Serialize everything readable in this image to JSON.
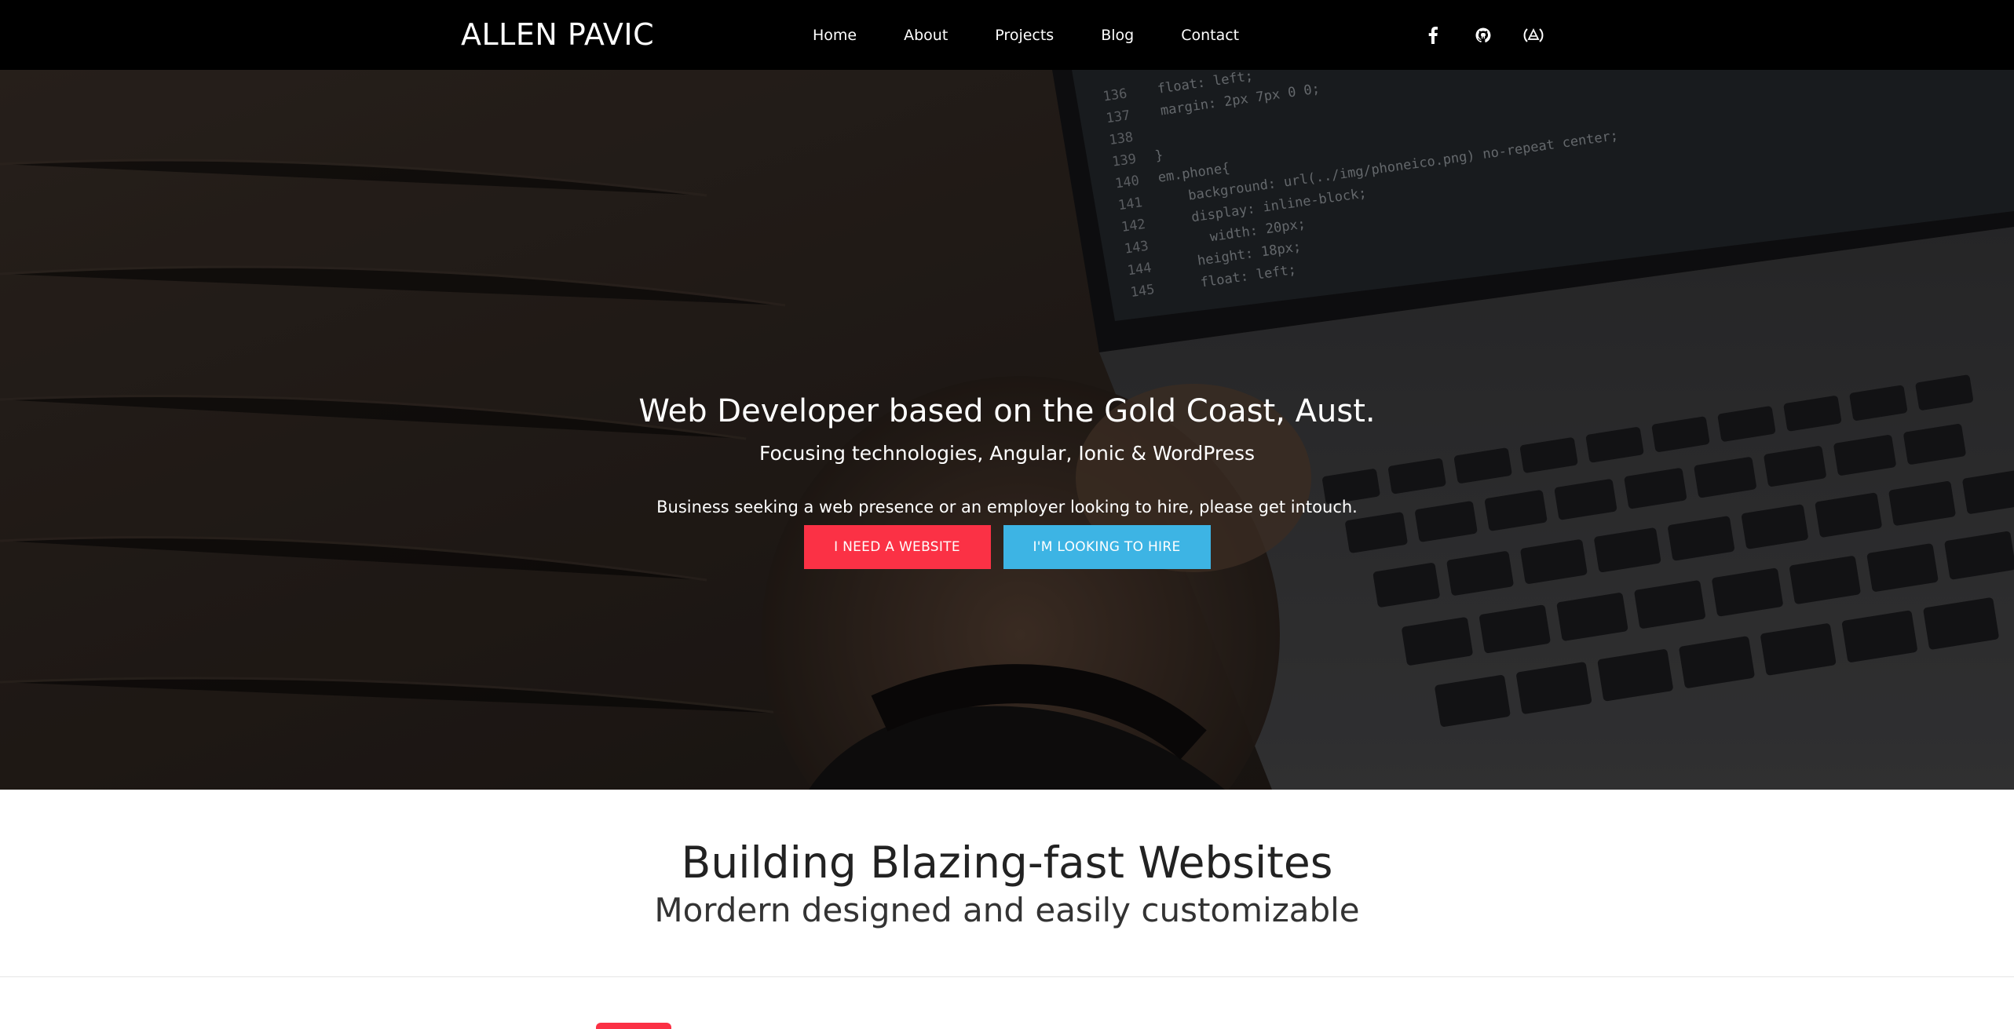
{
  "brand": {
    "name": "ALLEN PAVIC"
  },
  "nav": {
    "items": [
      {
        "label": "Home"
      },
      {
        "label": "About"
      },
      {
        "label": "Projects"
      },
      {
        "label": "Blog"
      },
      {
        "label": "Contact"
      }
    ],
    "social": [
      {
        "icon": "facebook-icon"
      },
      {
        "icon": "github-icon"
      },
      {
        "icon": "codepen-icon"
      }
    ]
  },
  "hero": {
    "title": "Web Developer based on the Gold Coast, Aust.",
    "subtitle": "Focusing technologies, Angular, Ionic & WordPress",
    "cta_text": "Business seeking a web presence or an employer looking to hire, please get intouch.",
    "button_website": "I NEED A WEBSITE",
    "button_hire": "I'M LOOKING TO HIRE",
    "code_lines": [
      {
        "num": "136",
        "code": "float: left;"
      },
      {
        "num": "137",
        "code": "margin: 2px 7px 0 0;"
      },
      {
        "num": "138",
        "code": ""
      },
      {
        "num": "139",
        "code": "}"
      },
      {
        "num": "140",
        "code": "em.phone{"
      },
      {
        "num": "141",
        "code": "background: url(../img/phoneico.png) no-repeat center;"
      },
      {
        "num": "142",
        "code": "display: inline-block;"
      },
      {
        "num": "143",
        "code": "width: 20px;"
      },
      {
        "num": "144",
        "code": "height: 18px;"
      },
      {
        "num": "145",
        "code": "float: left;"
      }
    ]
  },
  "feature": {
    "title": "Building Blazing-fast Websites",
    "subtitle": "Mordern designed and easily customizable"
  },
  "colors": {
    "accent_red": "#fb3145",
    "accent_blue": "#3db4e4",
    "nav_bg": "#000000"
  }
}
